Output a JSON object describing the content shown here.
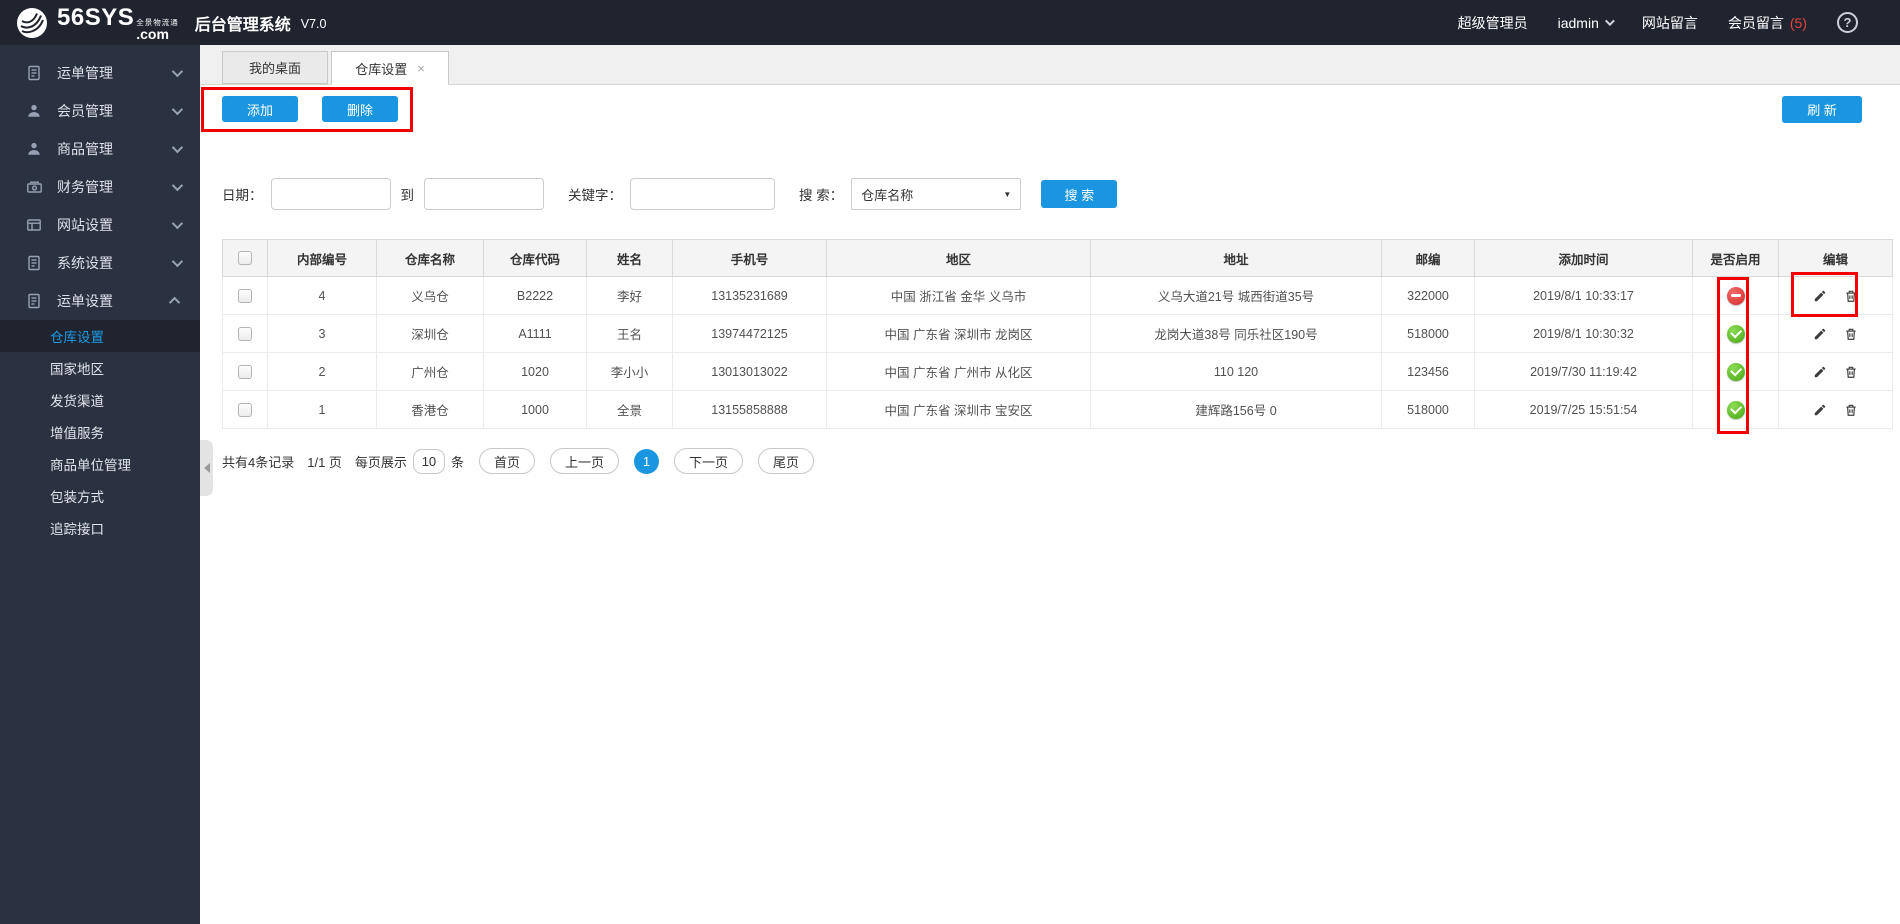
{
  "colors": {
    "accent_blue": "#1a96e0",
    "annotation_red": "#f30000",
    "status_green": "#46a411",
    "status_red": "#d62a2a",
    "header_bg": "#20242f",
    "sidebar_bg": "#2a3141",
    "active_link_blue": "#1b9ae8"
  },
  "header": {
    "brand": "56SYS",
    "brand_suffix": ".com",
    "brand_tagline": "全景物流通",
    "app_title": "后台管理系统",
    "version": "V7.0",
    "user_role": "超级管理员",
    "username": "iadmin",
    "nav_site_messages": "网站留言",
    "nav_member_messages": "会员留言",
    "member_message_count": "(5)",
    "help_glyph": "?"
  },
  "icons": {
    "logo": "swoosh-logo-icon",
    "user_dropdown": "chevron-down-icon",
    "help": "help-icon",
    "tab_close": "close-icon",
    "edit": "pencil-icon",
    "delete": "trash-icon",
    "enabled": "green-check-icon",
    "disabled": "red-minus-icon",
    "collapse": "collapse-left-icon"
  },
  "sidebar": {
    "menu": [
      {
        "label": "运单管理",
        "icon": "document-icon",
        "state": "collapsed"
      },
      {
        "label": "会员管理",
        "icon": "user-icon",
        "state": "collapsed"
      },
      {
        "label": "商品管理",
        "icon": "user-icon",
        "state": "collapsed"
      },
      {
        "label": "财务管理",
        "icon": "money-icon",
        "state": "collapsed"
      },
      {
        "label": "网站设置",
        "icon": "browser-icon",
        "state": "collapsed"
      },
      {
        "label": "系统设置",
        "icon": "document-icon",
        "state": "collapsed"
      },
      {
        "label": "运单设置",
        "icon": "document-icon",
        "state": "expanded"
      }
    ],
    "submenu": [
      {
        "label": "仓库设置",
        "active": true
      },
      {
        "label": "国家地区",
        "active": false
      },
      {
        "label": "发货渠道",
        "active": false
      },
      {
        "label": "增值服务",
        "active": false
      },
      {
        "label": "商品单位管理",
        "active": false
      },
      {
        "label": "包装方式",
        "active": false
      },
      {
        "label": "追踪接口",
        "active": false
      }
    ]
  },
  "tabs": [
    {
      "label": "我的桌面",
      "active": false,
      "closable": false
    },
    {
      "label": "仓库设置",
      "active": true,
      "closable": true,
      "close_glyph": "×"
    }
  ],
  "toolbar": {
    "add_label": "添加",
    "delete_label": "删除",
    "refresh_label": "刷 新"
  },
  "filters": {
    "date_label": "日期：",
    "to_label": "到",
    "keyword_label": "关键字：",
    "search_by_label": "搜 索：",
    "search_by_value": "仓库名称",
    "search_caret": "▼",
    "search_button_label": "搜 索"
  },
  "table": {
    "columns": [
      "内部编号",
      "仓库名称",
      "仓库代码",
      "姓名",
      "手机号",
      "地区",
      "地址",
      "邮编",
      "添加时间",
      "是否启用",
      "编辑"
    ],
    "rows": [
      {
        "id": "4",
        "name": "义乌仓",
        "code": "B2222",
        "contact": "李好",
        "phone": "13135231689",
        "region": "中国 浙江省 金华 义乌市",
        "address": "义乌大道21号 城西街道35号",
        "zip": "322000",
        "added": "2019/8/1 10:33:17",
        "enabled": false
      },
      {
        "id": "3",
        "name": "深圳仓",
        "code": "A1111",
        "contact": "王名",
        "phone": "13974472125",
        "region": "中国 广东省 深圳市 龙岗区",
        "address": "龙岗大道38号 同乐社区190号",
        "zip": "518000",
        "added": "2019/8/1 10:30:32",
        "enabled": true
      },
      {
        "id": "2",
        "name": "广州仓",
        "code": "1020",
        "contact": "李小小",
        "phone": "13013013022",
        "region": "中国 广东省 广州市 从化区",
        "address": "110 120",
        "zip": "123456",
        "added": "2019/7/30 11:19:42",
        "enabled": true
      },
      {
        "id": "1",
        "name": "香港仓",
        "code": "1000",
        "contact": "全景",
        "phone": "13155858888",
        "region": "中国 广东省 深圳市 宝安区",
        "address": "建辉路156号 0",
        "zip": "518000",
        "added": "2019/7/25 15:51:54",
        "enabled": true
      }
    ]
  },
  "pagination": {
    "summary": "共有4条记录",
    "page_info": "1/1 页",
    "per_page_label": "每页展示",
    "per_page_value": "10",
    "unit_label": "条",
    "first_label": "首页",
    "prev_label": "上一页",
    "current_page": "1",
    "next_label": "下一页",
    "last_label": "尾页"
  }
}
